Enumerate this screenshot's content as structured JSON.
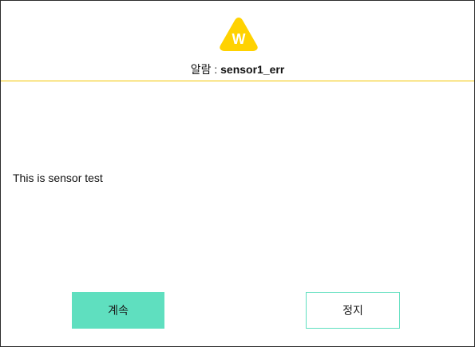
{
  "colors": {
    "warning": "#ffd200",
    "header_divider": "#f2c500",
    "accent": "#5fdfbf"
  },
  "header": {
    "icon": "warning-triangle-icon",
    "icon_letter": "W",
    "title_prefix": "알람 : ",
    "alarm_name": "sensor1_err"
  },
  "body": {
    "message": "This is sensor test"
  },
  "buttons": {
    "continue_label": "계속",
    "stop_label": "정지"
  }
}
